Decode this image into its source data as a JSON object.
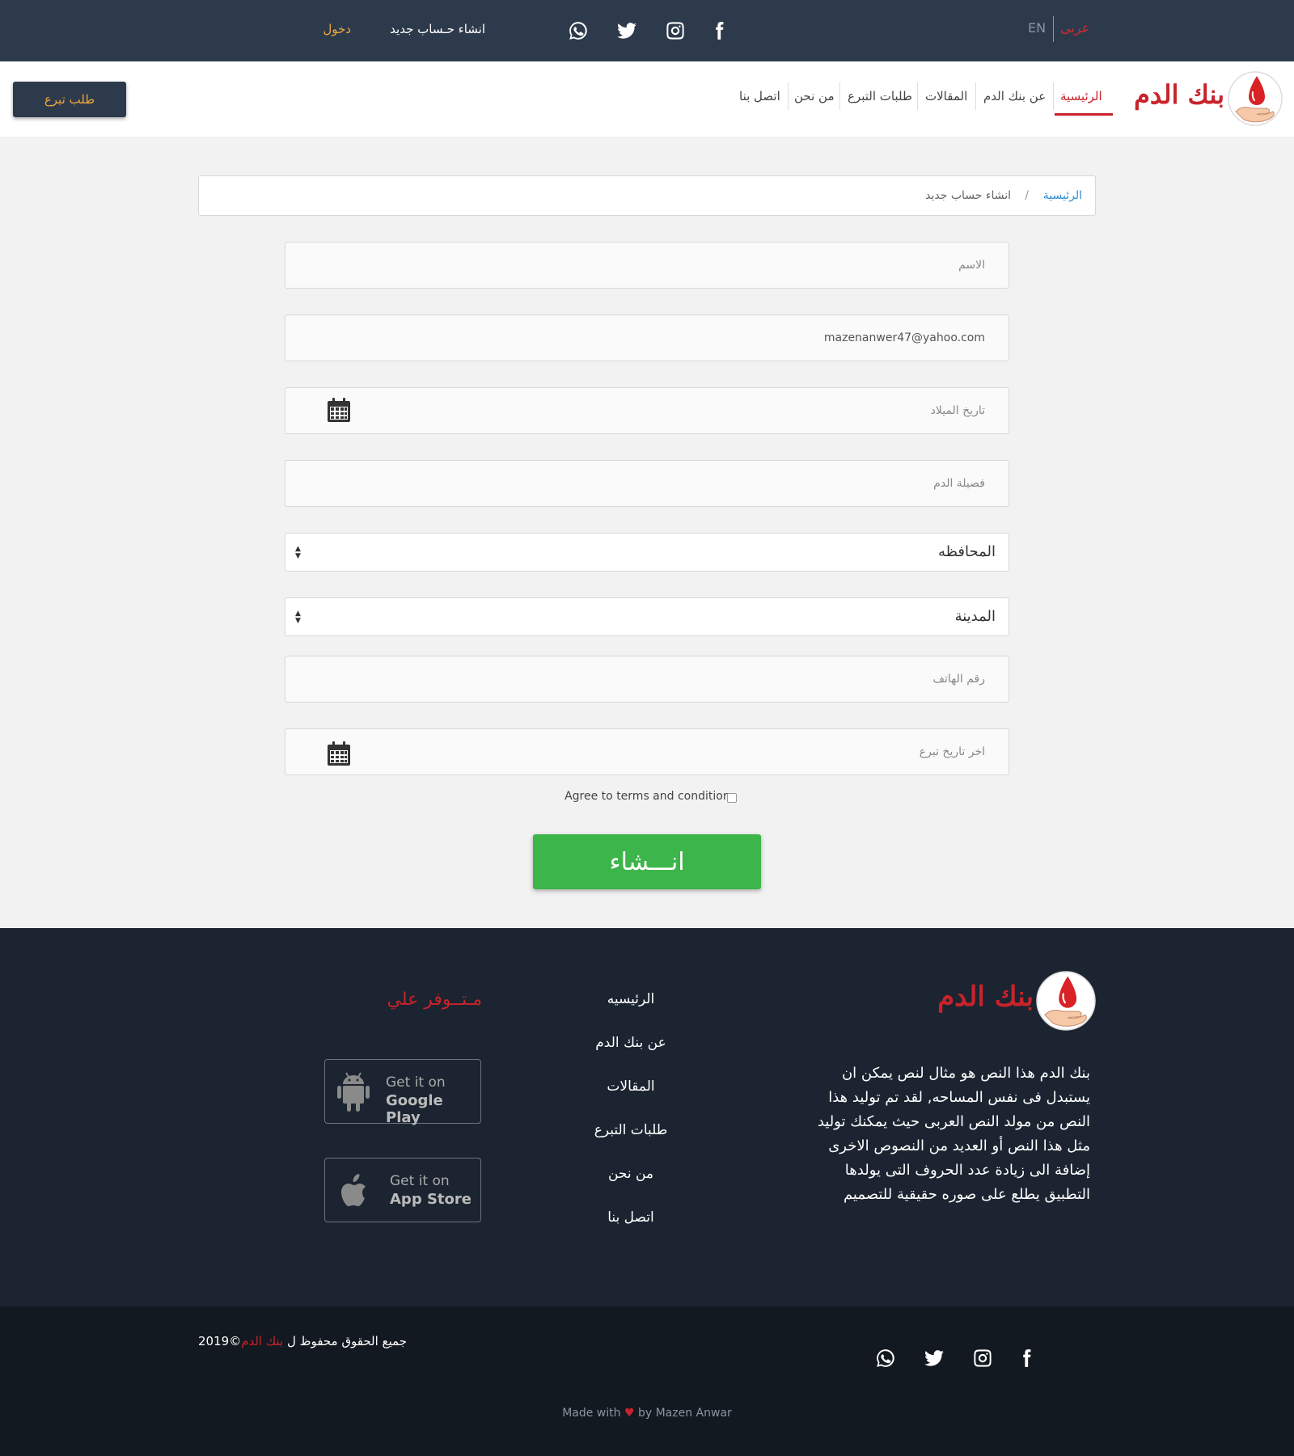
{
  "topbar": {
    "lang_arabic": "عربى",
    "lang_english": "EN",
    "register_link": "انشاء حـساب جديد",
    "login_link": "دخول",
    "social_icons": [
      "facebook-icon",
      "instagram-icon",
      "twitter-icon",
      "whatsapp-icon"
    ]
  },
  "navbar": {
    "brand": "بنك الدم",
    "items": [
      {
        "label": "الرئيسية",
        "active": true
      },
      {
        "label": "عن بنك الدم"
      },
      {
        "label": "المقالات"
      },
      {
        "label": "طلبات التبرع"
      },
      {
        "label": "من نحن"
      },
      {
        "label": "اتصل بنا"
      }
    ],
    "donate_button": "طلب تبرع"
  },
  "breadcrumb": {
    "home": "الرئيسية",
    "separator": "/",
    "current": "انشاء حساب جديد"
  },
  "form": {
    "name_placeholder": "الاسم",
    "email_value": "mazenanwer47@yahoo.com",
    "birthdate_placeholder": "تاريخ الميلاد",
    "blood_type_placeholder": "فصيلة الدم",
    "governorate_label": "المحافظه",
    "city_label": "المدينة",
    "phone_placeholder": "رقم الهاتف",
    "last_donation_placeholder": "اخر تاريخ تبرع",
    "terms_label": "Agree to terms and conditions",
    "submit_label": "انـــشاء"
  },
  "footer": {
    "brand": "بنك الدم",
    "about": "بنك الدم هذا النص هو مثال لنص يمكن ان يستبدل فى نفس المساحه, لقد تم توليد هذا النص من مولد النص العربى حيث يمكنك توليد مثل هذا النص أو العديد من النصوص الاخرى إضافة الى زيادة عدد الحروف التى يولدها التطبيق يطلع على صوره حقيقية للتصميم",
    "links": [
      "الرئيسيه",
      "عن بنك الدم",
      "المقالات",
      "طلبات التبرع",
      "من نحن",
      "اتصل بنا"
    ],
    "available_on": "مـتــوفر علي",
    "google_play": {
      "small": "Get it on",
      "big": "Google Play"
    },
    "app_store": {
      "small": "Get it on",
      "big": "App Store"
    }
  },
  "bottom": {
    "copyright_prefix": "جميع الحقوق محفوظ ل",
    "copyright_brand": "بنك الدم",
    "copyright_year": "©2019",
    "made_with_prefix": "Made with",
    "made_with_suffix": "by Mazen Anwar"
  },
  "colors": {
    "topbar": "#2d3a4b",
    "brand_red": "#c8232b",
    "accent_orange": "#f0a73a",
    "submit_green": "#3cb54a",
    "footer": "#1b2430",
    "bottom": "#131920"
  }
}
